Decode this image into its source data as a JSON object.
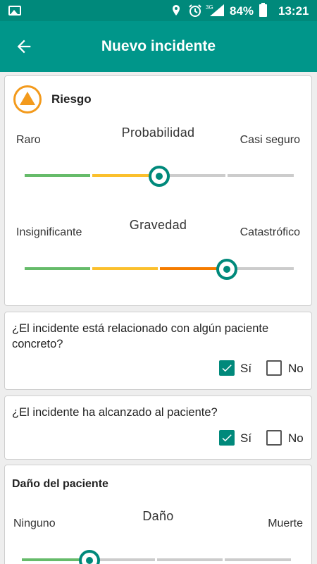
{
  "status_bar": {
    "network": "3G",
    "battery": "84%",
    "time": "13:21"
  },
  "app_bar": {
    "title": "Nuevo incidente"
  },
  "risk": {
    "label": "Riesgo",
    "probability": {
      "title": "Probabilidad",
      "min_label": "Raro",
      "max_label": "Casi seguro",
      "value": 0.5
    },
    "severity": {
      "title": "Gravedad",
      "min_label": "Insignificante",
      "max_label": "Catastrófico",
      "value": 0.75
    }
  },
  "q1": {
    "text": "¿El incidente está relacionado con algún paciente concreto?",
    "yes": "Sí",
    "no": "No",
    "selected": "yes"
  },
  "q2": {
    "text": "¿El incidente ha alcanzado al paciente?",
    "yes": "Sí",
    "no": "No",
    "selected": "yes"
  },
  "damage": {
    "label": "Daño del paciente",
    "slider": {
      "title": "Daño",
      "min_label": "Ninguno",
      "max_label": "Muerte",
      "value": 0.25
    }
  },
  "colors": {
    "primary": "#00897b",
    "green": "#66bb6a",
    "yellow": "#fbc02d",
    "orange": "#f57c00",
    "gray": "#cccccc",
    "warning": "#f39a1c"
  }
}
